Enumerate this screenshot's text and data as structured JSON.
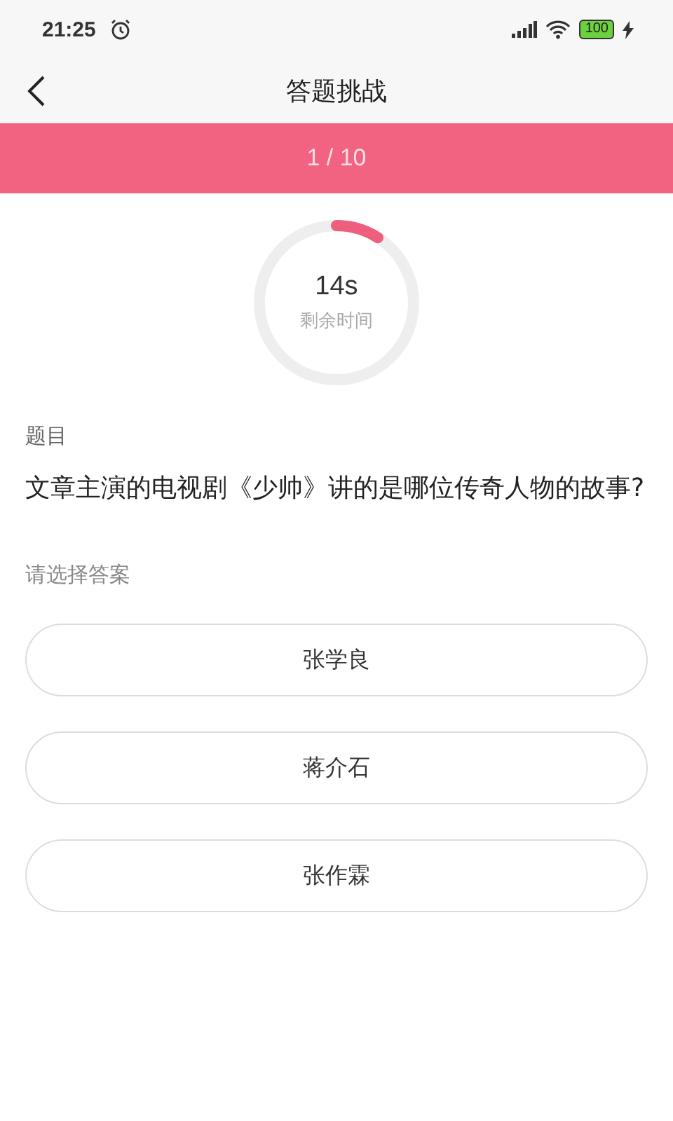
{
  "status_bar": {
    "time": "21:25",
    "battery": "100"
  },
  "header": {
    "title": "答题挑战"
  },
  "progress": {
    "text": "1 / 10"
  },
  "timer": {
    "value": "14s",
    "label": "剩余时间",
    "level": 0.09
  },
  "question": {
    "label": "题目",
    "text": "文章主演的电视剧《少帅》讲的是哪位传奇人物的故事?"
  },
  "answer_prompt": "请选择答案",
  "options": [
    {
      "label": "张学良",
      "selected": false
    },
    {
      "label": "蒋介石",
      "selected": false
    },
    {
      "label": "张作霖",
      "selected": false
    }
  ]
}
